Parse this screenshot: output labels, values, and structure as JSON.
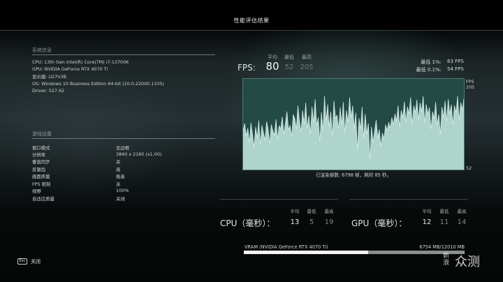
{
  "screen_title": "性能评估结果",
  "system_info": {
    "heading": "系统信息",
    "lines": [
      "CPU:  13th Gen Intel(R) Core(TM) i7-13700K",
      "GPU:  NVIDIA GeForce RTX 4070 Ti",
      "显示器:  U27V3B",
      "OS: Windows 10 Business Edition 64-bit (10.0.22000.1335)",
      "Driver: 527.62"
    ]
  },
  "game_settings": {
    "heading": "游戏设置",
    "rows": [
      {
        "label": "窗口模式",
        "value": "无边框"
      },
      {
        "label": "分辨率",
        "value": "3840 x 2160 (x1.00)"
      },
      {
        "label": "垂直同步",
        "value": "关"
      },
      {
        "label": "反锯齿",
        "value": "高"
      },
      {
        "label": "画面质量",
        "value": "极高"
      },
      {
        "label": "FPS 限制",
        "value": "关"
      },
      {
        "label": "视野",
        "value": "100%"
      },
      {
        "label": "自适应质量",
        "value": "关闭"
      }
    ]
  },
  "fps": {
    "label": "FPS:",
    "col_avg": "平均",
    "col_min": "最低",
    "col_max": "最高",
    "avg": "80",
    "min": "52",
    "max": "205",
    "low1_label": "最低 1%:",
    "low1_value": "63 FPS",
    "low01_label": "最低 0.1%:",
    "low01_value": "54 FPS"
  },
  "chart_data": {
    "type": "area",
    "axis_unit": "FPS",
    "ymax_label": "205",
    "ymin_label": "52",
    "ylim": [
      52,
      205
    ],
    "fill_color": "#bfe3da",
    "values": [
      118,
      130,
      109,
      122,
      98,
      131,
      112,
      90,
      124,
      106,
      135,
      95,
      127,
      114,
      102,
      133,
      120,
      96,
      128,
      118,
      110,
      137,
      104,
      126,
      121,
      141,
      112,
      130,
      150,
      119,
      127,
      108,
      145,
      138,
      121,
      160,
      134,
      116,
      152,
      129,
      165,
      122,
      143,
      112,
      158,
      131,
      171,
      126,
      140,
      100,
      149,
      118,
      176,
      133,
      162,
      124,
      150,
      108,
      168,
      139,
      144,
      120,
      157,
      128,
      166,
      115,
      152,
      132,
      174,
      140,
      160,
      121,
      148,
      85,
      139,
      120,
      158,
      104,
      146,
      112,
      130,
      70,
      124,
      98,
      118,
      136,
      106,
      120,
      92,
      114,
      104,
      128,
      118,
      132,
      122,
      140,
      128,
      146,
      134,
      160,
      124,
      152,
      140,
      167,
      132,
      158,
      146,
      174,
      128,
      160,
      148,
      170,
      136,
      165,
      150,
      176,
      131,
      162,
      145,
      157,
      120,
      150,
      138,
      166,
      127,
      145,
      112,
      158,
      140,
      168,
      133,
      171,
      146,
      162,
      128,
      160,
      148,
      176,
      135,
      165,
      153,
      172
    ]
  },
  "rendered_frames": "已渲染帧数: 6798 帧，耗时 85 秒。",
  "cpu": {
    "label": "CPU（毫秒）：",
    "col_avg": "平均",
    "col_min": "最低",
    "col_max": "最高",
    "avg": "13",
    "min": "5",
    "max": "19"
  },
  "gpu": {
    "label": "GPU（毫秒）：",
    "col_avg": "平均",
    "col_min": "最低",
    "col_max": "最高",
    "avg": "12",
    "min": "11",
    "max": "14"
  },
  "vram": {
    "label": "VRAM (NVIDIA GeForce RTX 4070 Ti)",
    "value": "6754 MB/12010 MB",
    "used_fraction": 0.5624
  },
  "footer": {
    "esc_key": "Esc",
    "close_label": "关闭"
  },
  "watermark": {
    "text_small": "新浪",
    "text_large": "众测"
  }
}
